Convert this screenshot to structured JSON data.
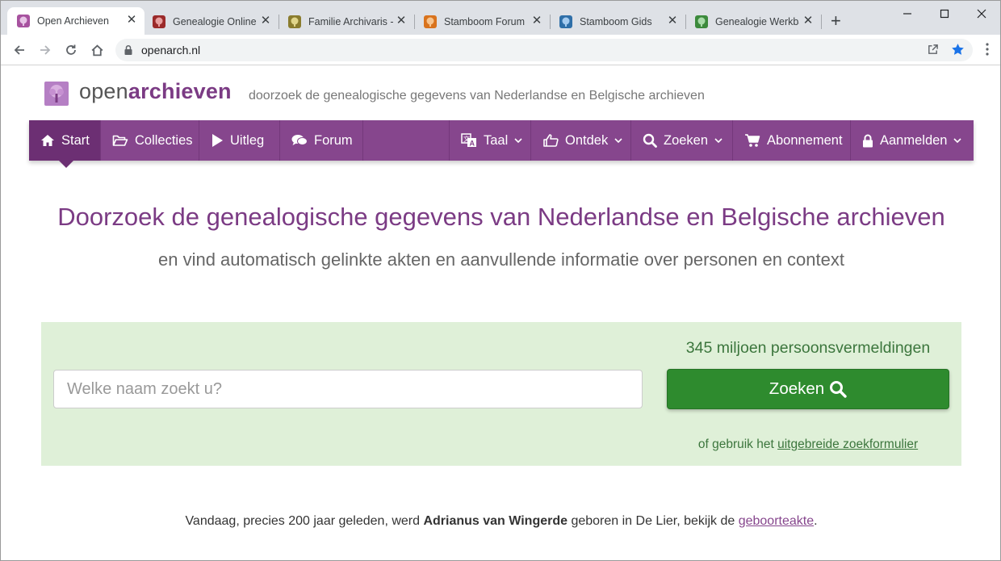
{
  "browser": {
    "tabs": [
      {
        "title": "Open Archieven",
        "color": "#a7529f",
        "active": true
      },
      {
        "title": "Genealogie Online",
        "color": "#9b2a2a",
        "active": false
      },
      {
        "title": "Familie Archivaris -",
        "color": "#8a7c2e",
        "active": false
      },
      {
        "title": "Stamboom Forum",
        "color": "#d9731d",
        "active": false
      },
      {
        "title": "Stamboom Gids",
        "color": "#2f6fa8",
        "active": false
      },
      {
        "title": "Genealogie Werkba",
        "color": "#3c8a3c",
        "active": false
      }
    ],
    "new_tab": "+",
    "close_glyph": "✕",
    "url": "openarch.nl"
  },
  "site": {
    "logo_part1": "open",
    "logo_part2": "archieven",
    "tagline": "doorzoek de genealogische gegevens van Nederlandse en Belgische archieven",
    "nav": [
      {
        "label": "Start",
        "icon": "home-icon"
      },
      {
        "label": "Collecties",
        "icon": "folder-open-icon"
      },
      {
        "label": "Uitleg",
        "icon": "play-icon"
      },
      {
        "label": "Forum",
        "icon": "comments-icon"
      },
      {
        "label": "Taal",
        "icon": "language-icon"
      },
      {
        "label": "Ontdek",
        "icon": "hand-point-icon"
      },
      {
        "label": "Zoeken",
        "icon": "search-icon"
      },
      {
        "label": "Abonnement",
        "icon": "cart-icon"
      },
      {
        "label": "Aanmelden",
        "icon": "lock-icon"
      }
    ],
    "hero_title": "Doorzoek de genealogische gegevens van Nederlandse en Belgische archieven",
    "hero_sub": "en vind automatisch gelinkte akten en aanvullende informatie over personen en context",
    "search": {
      "count": "345 miljoen persoonsvermeldingen",
      "placeholder": "Welke naam zoekt u?",
      "button": "Zoeken",
      "alt_prefix": "of gebruik het ",
      "alt_link": "uitgebreide zoekformulier"
    },
    "today": {
      "prefix": "Vandaag, precies 200 jaar geleden, werd ",
      "name": "Adrianus van Wingerde",
      "middle": " geboren in De Lier, bekijk de ",
      "link": "geboorteakte",
      "suffix": "."
    }
  }
}
